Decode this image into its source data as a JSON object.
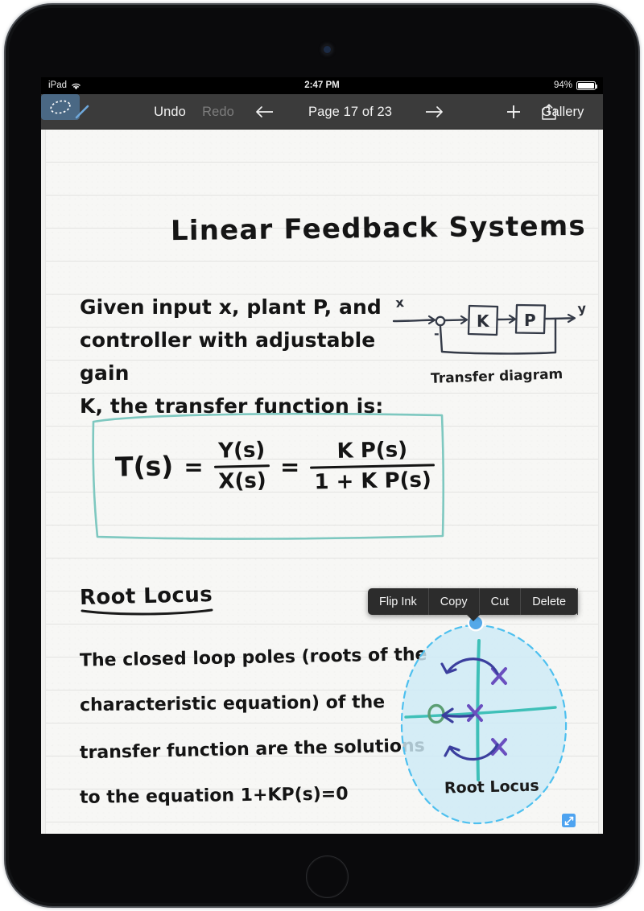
{
  "status_bar": {
    "device": "iPad",
    "wifi_icon": "wifi-icon",
    "time": "2:47 PM",
    "battery_percent": "94%",
    "battery_level": 94
  },
  "toolbar": {
    "pen_tool": "pen-icon",
    "lasso_tool": "lasso-selection-icon",
    "lasso_active": true,
    "undo_label": "Undo",
    "redo_label": "Redo",
    "redo_disabled": true,
    "prev_page_icon": "arrow-left-icon",
    "page_indicator": "Page 17 of 23",
    "next_page_icon": "arrow-right-icon",
    "add_icon": "plus-icon",
    "share_icon": "share-icon",
    "gallery_label": "Gallery"
  },
  "note": {
    "title": "Linear Feedback Systems",
    "paragraph_1": [
      "Given input x, plant P, and",
      "controller with adjustable gain",
      "K, the transfer function is:"
    ],
    "equation": {
      "lhs": "T(s)",
      "equals_1": "=",
      "fraction_1": {
        "numerator": "Y(s)",
        "denominator": "X(s)"
      },
      "equals_2": "=",
      "fraction_2": {
        "numerator": "K P(s)",
        "denominator": "1 + K P(s)"
      },
      "box_color": "#7ec8c0"
    },
    "diagram": {
      "caption": "Transfer diagram",
      "input_label": "x",
      "output_label": "y",
      "sum_sign": "-",
      "block_1": "K",
      "block_2": "P"
    },
    "section_heading": "Root Locus",
    "paragraph_2": [
      "The closed loop poles (roots of the",
      "characteristic equation) of the",
      "transfer function are the solutions",
      "to the equation  1+KP(s)=0"
    ],
    "root_locus": {
      "caption": "Root Locus",
      "pole_marker": "x",
      "zero_marker": "o",
      "pole_count": 3,
      "zero_count": 1,
      "axis_color": "#3fc0b8",
      "pole_color": "#6a4fbf",
      "zero_color": "#5a9e73",
      "arrow_color": "#3b3f9e"
    }
  },
  "selection": {
    "active": true,
    "fill_color": "#cdeaf6",
    "border_color": "#4ec0ef",
    "handle_color": "#54a8e8"
  },
  "context_menu": {
    "items": [
      {
        "label": "Flip Ink"
      },
      {
        "label": "Copy"
      },
      {
        "label": "Cut"
      },
      {
        "label": "Delete"
      }
    ]
  },
  "page_badges": {
    "expand_icon": "expand-image-icon",
    "page_turn_icon": "page-turn-corner-icon"
  }
}
